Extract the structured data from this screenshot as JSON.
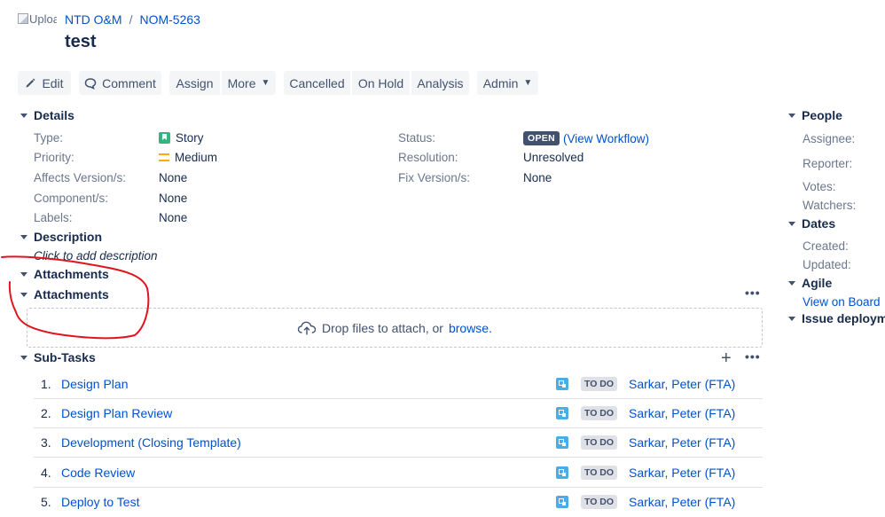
{
  "header": {
    "avatar_alt": "Uploa",
    "breadcrumb": {
      "project": "NTD O&M",
      "separator": "/",
      "issue_key": "NOM-5263"
    },
    "title": "test"
  },
  "toolbar": {
    "edit": "Edit",
    "comment": "Comment",
    "assign": "Assign",
    "more": "More",
    "cancelled": "Cancelled",
    "on_hold": "On Hold",
    "analysis": "Analysis",
    "admin": "Admin"
  },
  "details": {
    "heading": "Details",
    "type_label": "Type:",
    "type_value": "Story",
    "priority_label": "Priority:",
    "priority_value": "Medium",
    "affects_label": "Affects Version/s:",
    "affects_value": "None",
    "component_label": "Component/s:",
    "component_value": "None",
    "labels_label": "Labels:",
    "labels_value": "None",
    "status_label": "Status:",
    "status_value": "OPEN",
    "workflow_open": "(",
    "workflow_link": "View Workflow",
    "workflow_close": ")",
    "resolution_label": "Resolution:",
    "resolution_value": "Unresolved",
    "fix_label": "Fix Version/s:",
    "fix_value": "None"
  },
  "description": {
    "heading": "Description",
    "placeholder": "Click to add description"
  },
  "attachments": {
    "heading_1": "Attachments",
    "heading_2": "Attachments",
    "drop_text": "Drop files to attach, or",
    "browse_link": "browse."
  },
  "subtasks": {
    "heading": "Sub-Tasks",
    "items": [
      {
        "num": "1.",
        "summary": "Design Plan",
        "status": "TO DO",
        "assignee": "Sarkar, Peter (FTA)"
      },
      {
        "num": "2.",
        "summary": "Design Plan Review",
        "status": "TO DO",
        "assignee": "Sarkar, Peter (FTA)"
      },
      {
        "num": "3.",
        "summary": "Development (Closing Template)",
        "status": "TO DO",
        "assignee": "Sarkar, Peter (FTA)"
      },
      {
        "num": "4.",
        "summary": "Code Review",
        "status": "TO DO",
        "assignee": "Sarkar, Peter (FTA)"
      },
      {
        "num": "5.",
        "summary": "Deploy to Test",
        "status": "TO DO",
        "assignee": "Sarkar, Peter (FTA)"
      }
    ]
  },
  "sidebar": {
    "people_heading": "People",
    "assignee_label": "Assignee:",
    "reporter_label": "Reporter:",
    "votes_label": "Votes:",
    "watchers_label": "Watchers:",
    "dates_heading": "Dates",
    "created_label": "Created:",
    "updated_label": "Updated:",
    "agile_heading": "Agile",
    "view_on_board": "View on Board",
    "deployment_heading": "Issue deploymen"
  },
  "colors": {
    "link": "#0052cc",
    "story_icon": "#36b37e",
    "priority_medium": "#ffab00",
    "subtask_icon": "#4bade8",
    "annotation": "#e0141e"
  }
}
